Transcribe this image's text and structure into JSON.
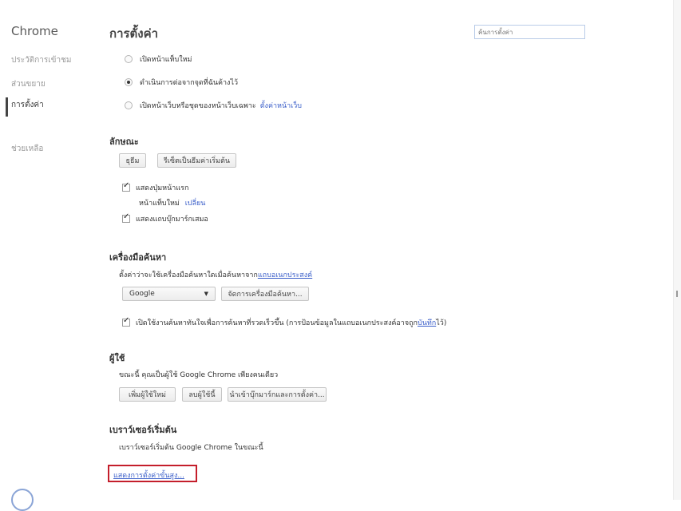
{
  "sidebar": {
    "title": "Chrome",
    "items": [
      {
        "label": "ประวัติการเข้าชม"
      },
      {
        "label": "ส่วนขยาย"
      },
      {
        "label": "การตั้งค่า"
      },
      {
        "label": "ช่วยเหลือ"
      }
    ]
  },
  "header": {
    "title": "การตั้งค่า",
    "search_placeholder": "ค้นการตั้งค่า"
  },
  "startup": {
    "options": [
      {
        "label": "เปิดหน้าแท็บใหม่",
        "checked": false
      },
      {
        "label": "ดำเนินการต่อจากจุดที่ฉันค้างไว้",
        "checked": true
      },
      {
        "label": "เปิดหน้าเว็บหรือชุดของหน้าเว็บเฉพาะ",
        "checked": false,
        "link": "ตั้งค่าหน้าเว็บ"
      }
    ]
  },
  "appearance": {
    "title": "ลักษณะ",
    "buttons": [
      "ธุธีม",
      "รีเซ็ตเป็นธีมค่าเริ่มต้น"
    ],
    "show_home": {
      "label": "แสดงปุ่มหน้าแรก",
      "checked": true
    },
    "home_page_text": "หน้าแท็บใหม่",
    "home_change_link": "เปลี่ยน",
    "show_bookmarks": {
      "label": "แสดงแถบบุ๊กมาร์กเสมอ",
      "checked": true
    }
  },
  "search": {
    "title": "เครื่องมือค้นหา",
    "description": "ตั้งค่าว่าจะใช้เครื่องมือค้นหาใดเมื่อค้นหาจาก",
    "omnibox_link": "แถบอเนกประสงค์",
    "engine_selected": "Google",
    "manage_button": "จัดการเครื่องมือค้นหา...",
    "instant": {
      "checked": true,
      "label": "เปิดใช้งานค้นหาทันใจเพื่อการค้นหาที่รวดเร็วขึ้น (การป้อนข้อมูลในแถบอเนกประสงค์อาจถูก",
      "link": "บันทึก",
      "suffix": "ไว้)"
    }
  },
  "users": {
    "title": "ผู้ใช้",
    "description": "ขณะนี้ คุณเป็นผู้ใช้ Google Chrome เพียงคนเดียว",
    "buttons": [
      "เพิ่มผู้ใช้ใหม่",
      "ลบผู้ใช้นี้",
      "นำเข้าบุ๊กมาร์กและการตั้งค่า..."
    ]
  },
  "default_browser": {
    "title": "เบราว์เซอร์เริ่มต้น",
    "description": "เบราว์เซอร์เริ่มต้น Google Chrome ในขณะนี้"
  },
  "advanced_link": "แสดงการตั้งค่าขั้นสูง..."
}
